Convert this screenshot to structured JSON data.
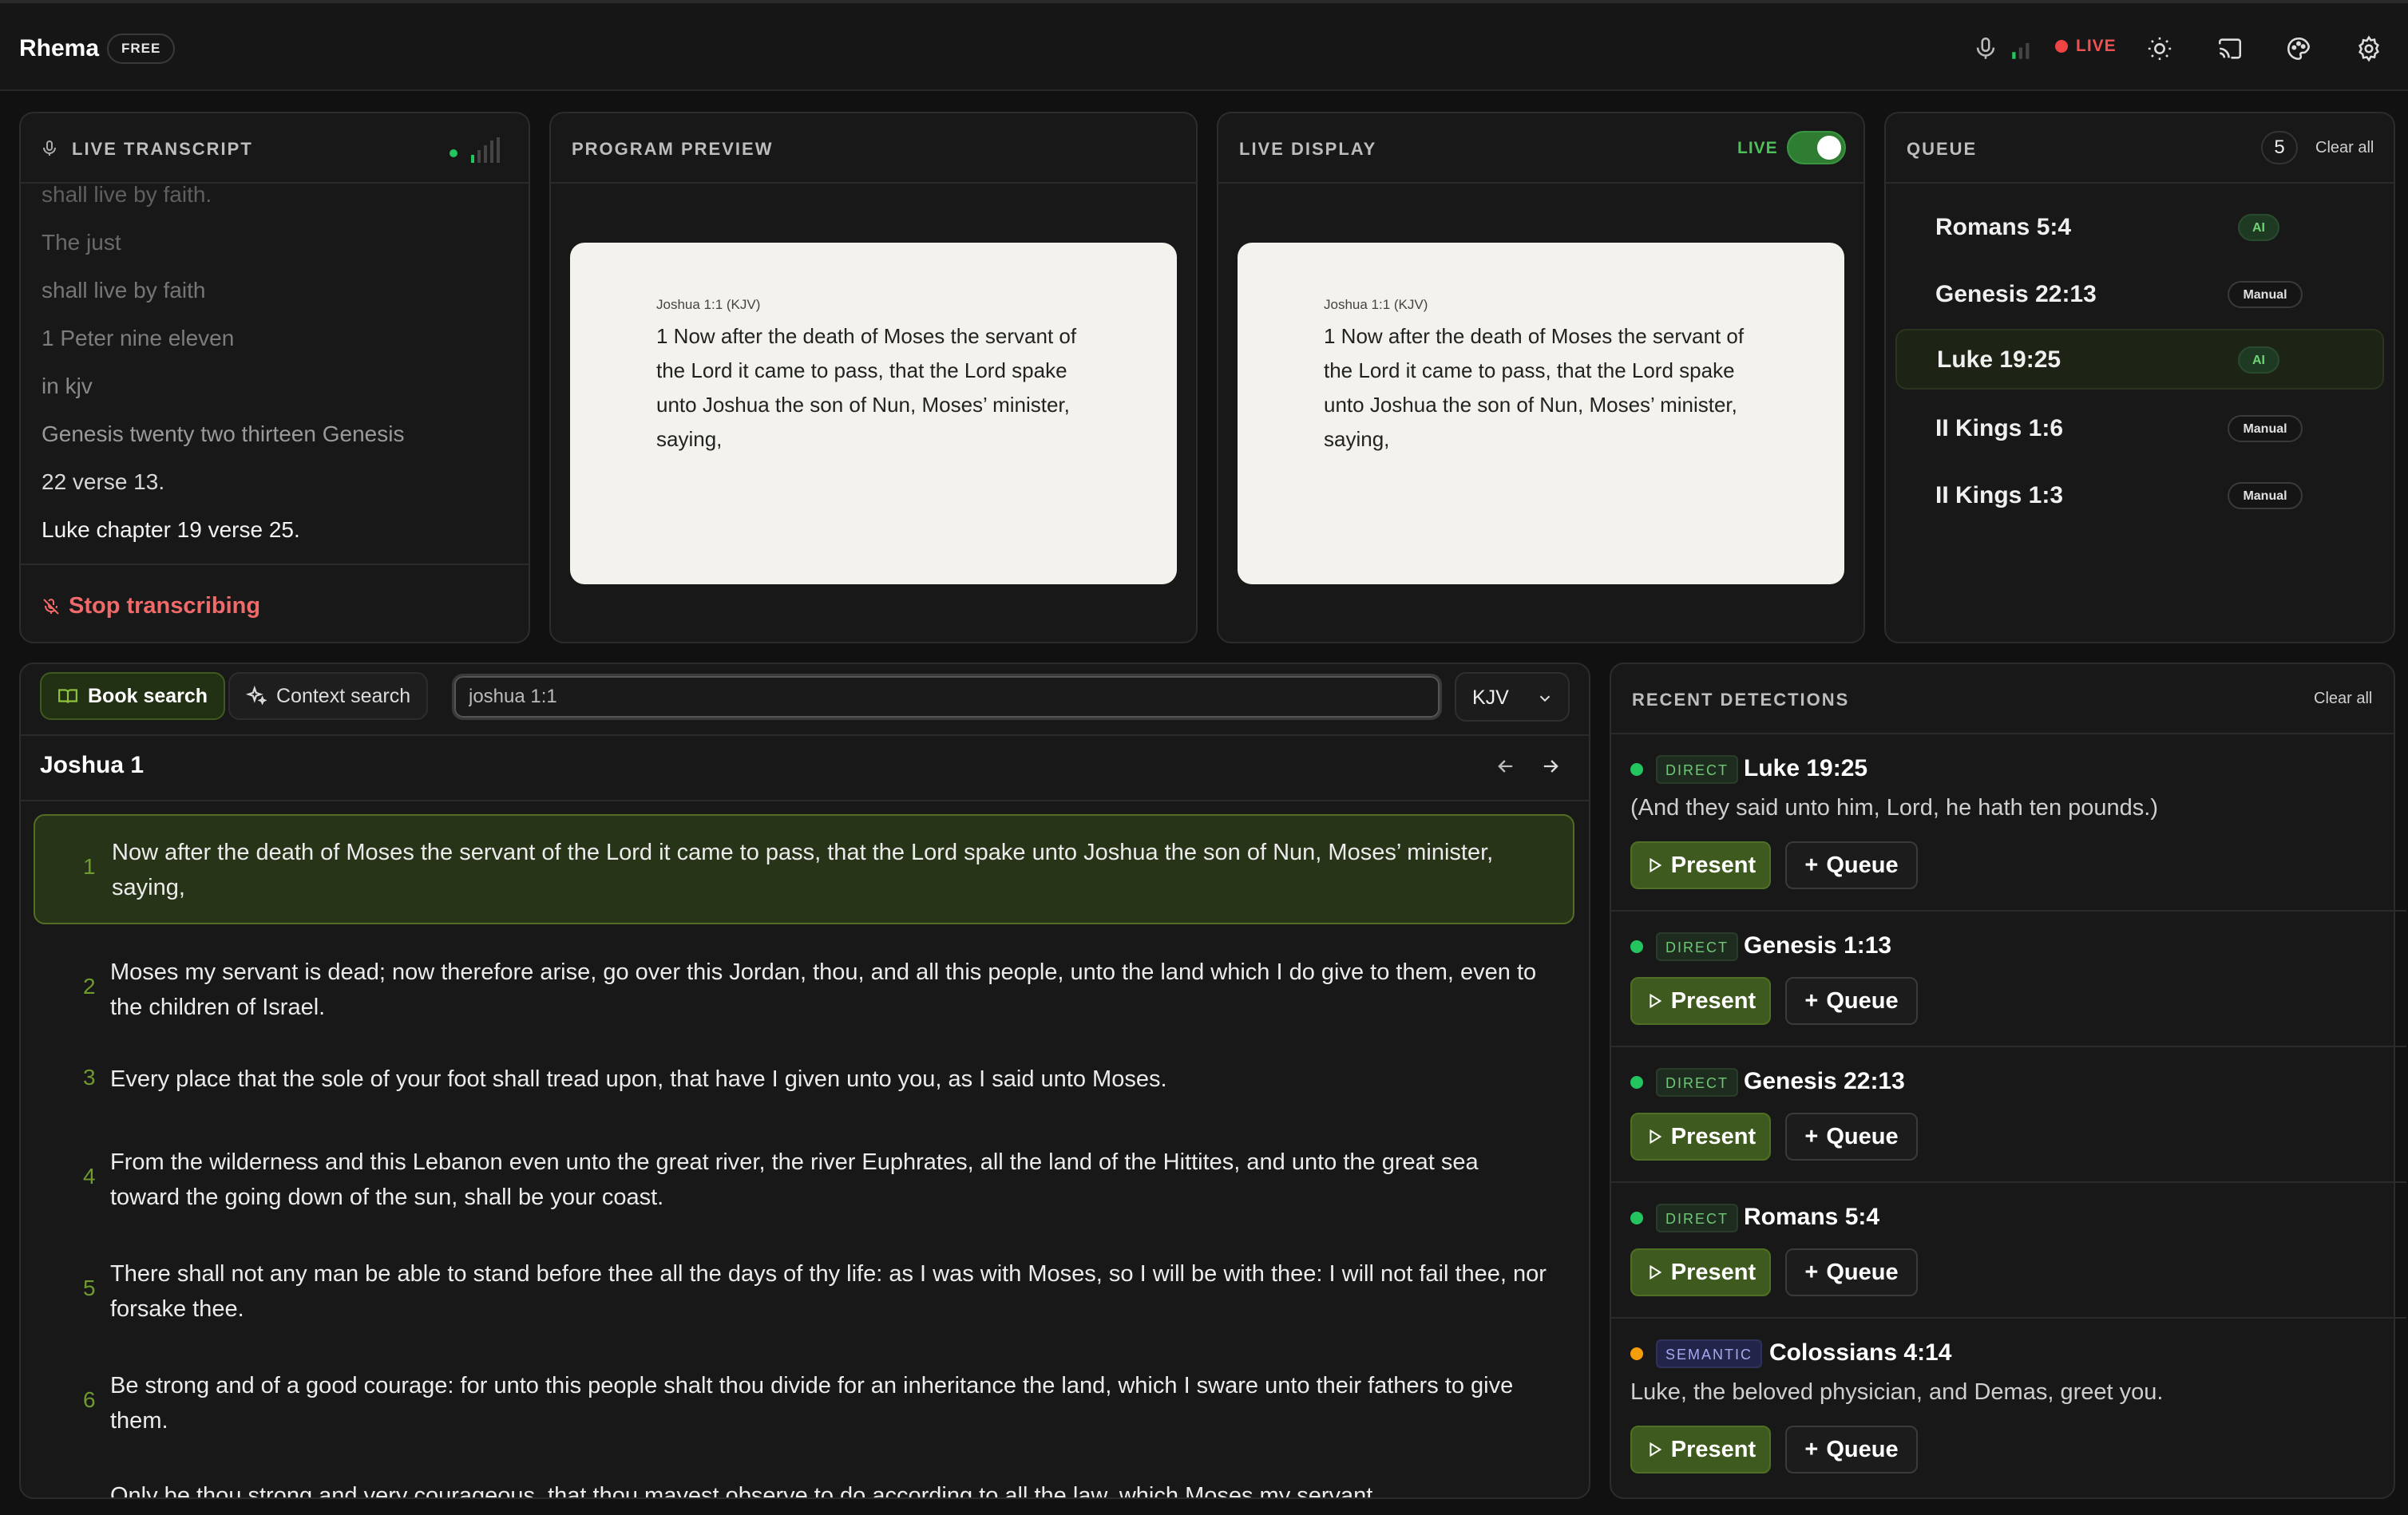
{
  "app": {
    "name": "Rhema",
    "plan": "FREE",
    "live_label": "LIVE"
  },
  "transcript": {
    "title": "LIVE TRANSCRIPT",
    "lines": [
      "shall live by faith.",
      "The just",
      "shall live by faith",
      "1 Peter nine eleven",
      "in kjv",
      "Genesis twenty two thirteen Genesis",
      "22 verse 13.",
      "Luke chapter 19 verse 25."
    ],
    "stop_label": "Stop transcribing"
  },
  "preview": {
    "title": "PROGRAM PREVIEW",
    "ref": "Joshua 1:1 (KJV)",
    "text": "1 Now after the death of Moses the servant of the Lord it came to pass, that the Lord spake unto Joshua the son of Nun, Moses’ minister, saying,"
  },
  "live_display": {
    "title": "LIVE DISPLAY",
    "live_label": "LIVE",
    "live_on": true,
    "ref": "Joshua 1:1 (KJV)",
    "text": "1 Now after the death of Moses the servant of the Lord it came to pass, that the Lord spake unto Joshua the son of Nun, Moses’ minister, saying,"
  },
  "queue": {
    "title": "QUEUE",
    "count": "5",
    "clear_label": "Clear all",
    "items": [
      {
        "ref": "Romans 5:4",
        "tag": "AI"
      },
      {
        "ref": "Genesis 22:13",
        "tag": "Manual"
      },
      {
        "ref": "Luke 19:25",
        "tag": "AI"
      },
      {
        "ref": "II Kings 1:6",
        "tag": "Manual"
      },
      {
        "ref": "II Kings 1:3",
        "tag": "Manual"
      }
    ]
  },
  "search": {
    "book_label": "Book search",
    "context_label": "Context search",
    "query": "joshua 1:1",
    "version": "KJV",
    "chapter_title": "Joshua 1",
    "verses": [
      {
        "num": "1",
        "text": "Now after the death of Moses the servant of the Lord it came to pass, that the Lord spake unto Joshua the son of Nun, Moses’ minister, saying,"
      },
      {
        "num": "2",
        "text": "Moses my servant is dead; now therefore arise, go over this Jordan, thou, and all this people, unto the land which I do give to them, even to the children of Israel."
      },
      {
        "num": "3",
        "text": "Every place that the sole of your foot shall tread upon, that have I given unto you, as I said unto Moses."
      },
      {
        "num": "4",
        "text": "From the wilderness and this Lebanon even unto the great river, the river Euphrates, all the land of the Hittites, and unto the great sea toward the going down of the sun, shall be your coast."
      },
      {
        "num": "5",
        "text": "There shall not any man be able to stand before thee all the days of thy life: as I was with Moses, so I will be with thee: I will not fail thee, nor forsake thee."
      },
      {
        "num": "6",
        "text": "Be strong and of a good courage: for unto this people shalt thou divide for an inheritance the land, which I sware unto their fathers to give them."
      },
      {
        "num": "",
        "text": "Only be thou strong and very courageous, that thou mayest observe to do according to all the law, which Moses my servant"
      }
    ]
  },
  "detections": {
    "title": "RECENT DETECTIONS",
    "clear_label": "Clear all",
    "present_label": "Present",
    "queue_label": "Queue",
    "items": [
      {
        "type": "DIRECT",
        "ref": "Luke 19:25",
        "text": "(And they said unto him, Lord, he hath ten pounds.)"
      },
      {
        "type": "DIRECT",
        "ref": "Genesis 1:13",
        "text": ""
      },
      {
        "type": "DIRECT",
        "ref": "Genesis 22:13",
        "text": ""
      },
      {
        "type": "DIRECT",
        "ref": "Romans 5:4",
        "text": ""
      },
      {
        "type": "SEMANTIC",
        "ref": "Colossians 4:14",
        "text": "Luke, the beloved physician, and Demas, greet you."
      }
    ]
  },
  "colors": {
    "accent": "#3f5a1e",
    "live": "#ef4444",
    "direct": "#22c55e",
    "semantic": "#f59e0b"
  }
}
